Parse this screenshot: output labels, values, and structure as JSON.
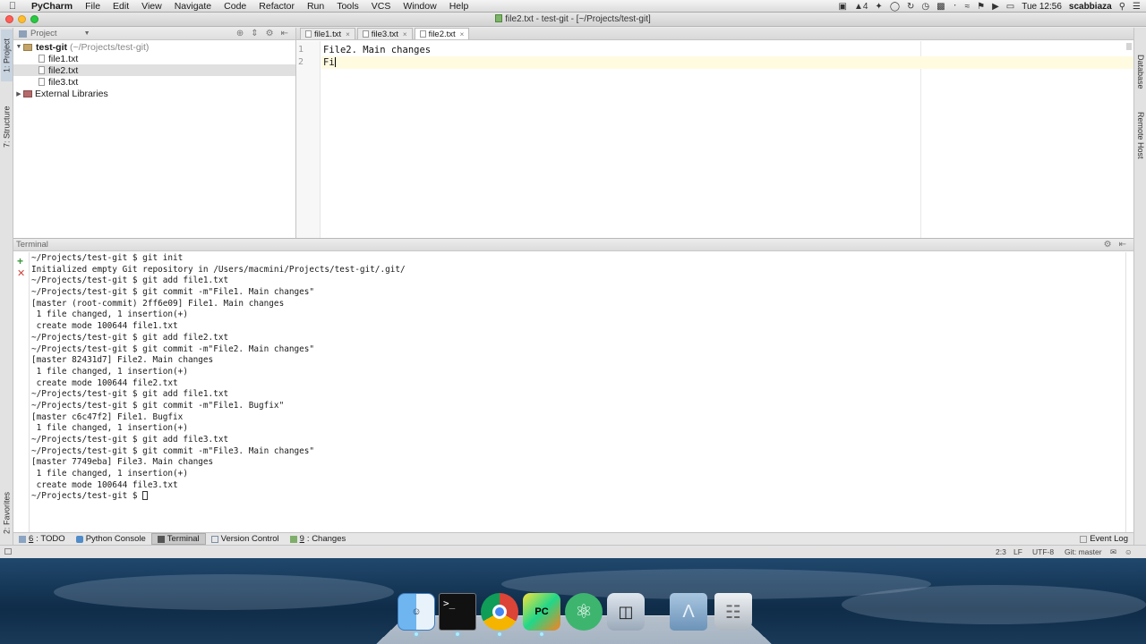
{
  "menubar": {
    "app_name": "PyCharm",
    "menus": [
      "File",
      "Edit",
      "View",
      "Navigate",
      "Code",
      "Refactor",
      "Run",
      "Tools",
      "VCS",
      "Window",
      "Help"
    ],
    "status_badge": "4",
    "clock": "Tue 12:56",
    "user": "scabbiaza"
  },
  "window": {
    "title": "file2.txt - test-git - [~/Projects/test-git]",
    "traffic_lights": [
      "#ff5f57",
      "#ffbd2e",
      "#28c940"
    ]
  },
  "left_strip": {
    "project_tab": "1: Project",
    "structure_tab": "7: Structure",
    "favorites_tab": "2: Favorites"
  },
  "right_strip": {
    "database_tab": "Database",
    "remote_host_tab": "Remote Host"
  },
  "project_panel": {
    "header": "Project",
    "root": {
      "name": "test-git",
      "path": "(~/Projects/test-git)"
    },
    "files": [
      "file1.txt",
      "file2.txt",
      "file3.txt"
    ],
    "selected_file": "file2.txt",
    "external": "External Libraries"
  },
  "editor": {
    "tabs": [
      "file1.txt",
      "file3.txt",
      "file2.txt"
    ],
    "active_tab": "file2.txt",
    "line_numbers": [
      "1",
      "2"
    ],
    "lines": [
      "File2. Main changes",
      "Fi"
    ]
  },
  "terminal": {
    "header": "Terminal",
    "lines": [
      "~/Projects/test-git $ git init",
      "Initialized empty Git repository in /Users/macmini/Projects/test-git/.git/",
      "~/Projects/test-git $ git add file1.txt",
      "~/Projects/test-git $ git commit -m\"File1. Main changes\"",
      "[master (root-commit) 2ff6e09] File1. Main changes",
      " 1 file changed, 1 insertion(+)",
      " create mode 100644 file1.txt",
      "~/Projects/test-git $ git add file2.txt",
      "~/Projects/test-git $ git commit -m\"File2. Main changes\"",
      "[master 82431d7] File2. Main changes",
      " 1 file changed, 1 insertion(+)",
      " create mode 100644 file2.txt",
      "~/Projects/test-git $ git add file1.txt",
      "~/Projects/test-git $ git commit -m\"File1. Bugfix\"",
      "[master c6c47f2] File1. Bugfix",
      " 1 file changed, 1 insertion(+)",
      "~/Projects/test-git $ git add file3.txt",
      "~/Projects/test-git $ git commit -m\"File3. Main changes\"",
      "[master 7749eba] File3. Main changes",
      " 1 file changed, 1 insertion(+)",
      " create mode 100644 file3.txt"
    ],
    "prompt": "~/Projects/test-git $ "
  },
  "toolwindows": {
    "todo_num": "6",
    "todo_label": ": TODO",
    "python_console": "Python Console",
    "terminal": "Terminal",
    "version_control": "Version Control",
    "changes_num": "9",
    "changes_label": ": Changes",
    "event_log": "Event Log"
  },
  "statusbar": {
    "position": "2:3",
    "line_sep": "LF",
    "encoding": "UTF-8",
    "vcs": "Git: master"
  },
  "dock": {
    "apps": [
      "finder-icon",
      "terminal-icon",
      "chrome-icon",
      "pycharm-icon",
      "atom-icon",
      "preview-icon",
      "applications-folder-icon",
      "trash-icon"
    ]
  }
}
